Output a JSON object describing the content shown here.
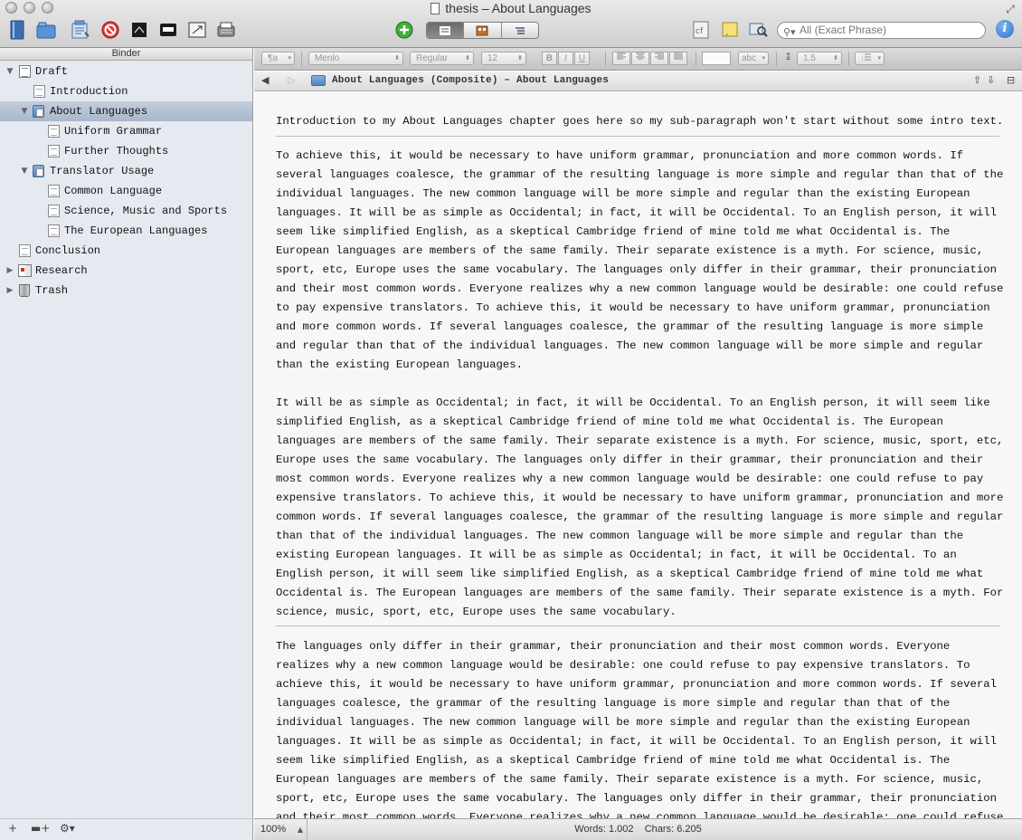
{
  "window": {
    "title": "thesis – About Languages"
  },
  "toolbar": {
    "icons": [
      "binder-icon",
      "collections-icon",
      "inspector-like-icon",
      "stop-icon",
      "black-square-icon",
      "keyboard-icon",
      "compose-icon",
      "print-icon",
      "add-icon",
      "split-view-icon",
      "cf-icon",
      "note-icon",
      "image-search-icon",
      "info-icon"
    ],
    "search_placeholder": "All (Exact Phrase)"
  },
  "binder": {
    "header": "Binder",
    "items": [
      {
        "label": "Draft",
        "level": 0,
        "type": "draft",
        "disclosure": "open"
      },
      {
        "label": "Introduction",
        "level": 1,
        "type": "doc"
      },
      {
        "label": "About Languages",
        "level": 1,
        "type": "folder",
        "disclosure": "open",
        "selected": true
      },
      {
        "label": "Uniform Grammar",
        "level": 2,
        "type": "doc"
      },
      {
        "label": "Further Thoughts",
        "level": 2,
        "type": "doc"
      },
      {
        "label": "Translator Usage",
        "level": 1,
        "type": "folder",
        "disclosure": "open"
      },
      {
        "label": "Common Language",
        "level": 2,
        "type": "doc"
      },
      {
        "label": "Science, Music and Sports",
        "level": 2,
        "type": "doc"
      },
      {
        "label": "The European Languages",
        "level": 2,
        "type": "doc"
      },
      {
        "label": "Conclusion",
        "level": 0,
        "type": "doc"
      },
      {
        "label": "Research",
        "level": 0,
        "type": "research",
        "disclosure": "closed"
      },
      {
        "label": "Trash",
        "level": 0,
        "type": "trash",
        "disclosure": "closed"
      }
    ]
  },
  "format_bar": {
    "paragraph_style": "¶a",
    "font_family": "Menlo",
    "font_style": "Regular",
    "font_size": "12",
    "bold": "B",
    "italic": "I",
    "underline": "U",
    "highlight": "abc",
    "line_spacing": "1.5"
  },
  "header": {
    "path": "About Languages (Composite) – About Languages"
  },
  "editor": {
    "paragraphs": [
      "Introduction to my About Languages chapter goes here so my sub-paragraph won't start without some intro text.",
      "To achieve this, it would be necessary to have uniform grammar, pronunciation and more common words. If several languages coalesce, the grammar of the resulting language is more simple and regular than that of the individual languages. The new common language will be more simple and regular than the existing European languages. It will be as simple as Occidental; in fact, it will be Occidental. To an English person, it will seem like simplified English, as a skeptical Cambridge friend of mine told me what Occidental is. The European languages are members of the same family. Their separate existence is a myth. For science, music, sport, etc, Europe uses the same vocabulary. The languages only differ in their grammar, their pronunciation and their most common words. Everyone realizes why a new common language would be desirable: one could refuse to pay expensive translators. To achieve this, it would be necessary to have uniform grammar, pronunciation and more common words. If several languages coalesce, the grammar of the resulting language is more simple and regular than that of the individual languages. The new common language will be more simple and regular than the existing European languages.",
      "It will be as simple as Occidental; in fact, it will be Occidental. To an English person, it will seem like simplified English, as a skeptical Cambridge friend of mine told me what Occidental is. The European languages are members of the same family. Their separate existence is a myth. For science, music, sport, etc, Europe uses the same vocabulary. The languages only differ in their grammar, their pronunciation and their most common words. Everyone realizes why a new common language would be desirable: one could refuse to pay expensive translators. To achieve this, it would be necessary to have uniform grammar, pronunciation and more common words. If several languages coalesce, the grammar of the resulting language is more simple and regular than that of the individual languages. The new common language will be more simple and regular than the existing European languages. It will be as simple as Occidental; in fact, it will be Occidental. To an English person, it will seem like simplified English, as a skeptical Cambridge friend of mine told me what Occidental is. The European languages are members of the same family. Their separate existence is a myth. For science, music, sport, etc, Europe uses the same vocabulary.",
      "The languages only differ in their grammar, their pronunciation and their most common words. Everyone realizes why a new common language would be desirable: one could refuse to pay expensive translators. To achieve this, it would be necessary to have uniform grammar, pronunciation and more common words. If several languages coalesce, the grammar of the resulting language is more simple and regular than that of the individual languages. The new common language will be more simple and regular than the existing European languages. It will be as simple as Occidental; in fact, it will be Occidental. To an English person, it will seem like simplified English, as a skeptical Cambridge friend of mine told me what Occidental is. The European languages are members of the same family. Their separate existence is a myth. For science, music, sport, etc, Europe uses the same vocabulary. The languages only differ in their grammar, their pronunciation and their most common words. Everyone realizes why a new common language would be desirable: one could refuse to pay expensive translators."
    ]
  },
  "status": {
    "zoom": "100%",
    "words": "Words: 1.002",
    "chars": "Chars: 6.205"
  }
}
